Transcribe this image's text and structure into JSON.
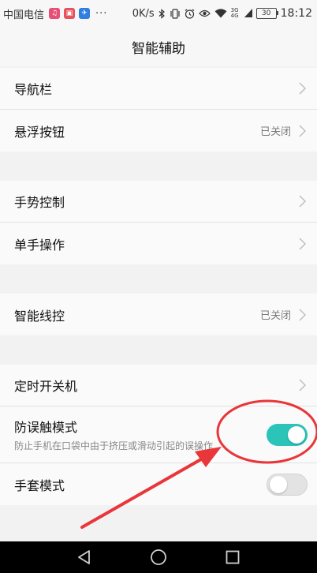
{
  "status_bar": {
    "carrier": "中国电信",
    "app_icons": [
      {
        "icon": "music-app-icon",
        "color": "#e84f76"
      },
      {
        "icon": "store-app-icon",
        "color": "#e8525b"
      },
      {
        "icon": "sports-app-icon",
        "color": "#2f7fe0"
      }
    ],
    "more": "···",
    "speed": "0K/s",
    "network": "3G 4G",
    "battery": "30",
    "time": "18:12"
  },
  "title": "智能辅助",
  "groups": [
    {
      "items": [
        {
          "label": "导航栏",
          "status": null,
          "control": "chevron"
        },
        {
          "label": "悬浮按钮",
          "status": "已关闭",
          "control": "chevron"
        }
      ]
    },
    {
      "items": [
        {
          "label": "手势控制",
          "status": null,
          "control": "chevron"
        },
        {
          "label": "单手操作",
          "status": null,
          "control": "chevron"
        }
      ]
    },
    {
      "items": [
        {
          "label": "智能线控",
          "status": "已关闭",
          "control": "chevron"
        }
      ]
    },
    {
      "items": [
        {
          "label": "定时开关机",
          "control": "chevron"
        },
        {
          "label": "防误触模式",
          "description": "防止手机在口袋中由于挤压或滑动引起的误操作",
          "control": "toggle",
          "on": true
        },
        {
          "label": "手套模式",
          "control": "toggle",
          "on": false
        }
      ]
    }
  ],
  "colors": {
    "toggle_on": "#2cc3b8",
    "annotation_red": "#e8363a"
  },
  "nav_bar": {
    "buttons": [
      "back-icon",
      "home-icon",
      "recents-icon"
    ]
  }
}
